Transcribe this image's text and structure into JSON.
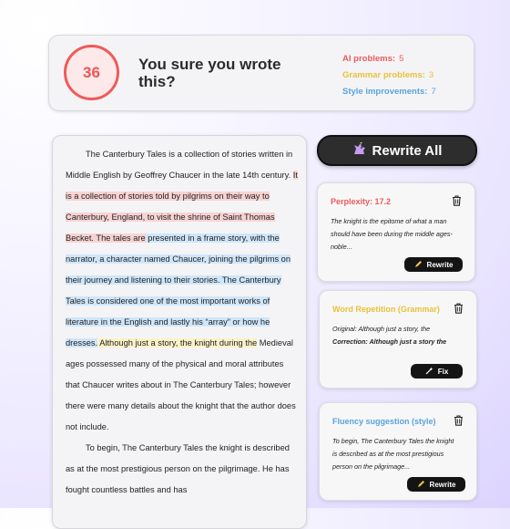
{
  "score": {
    "value": "36",
    "title": "You sure you wrote this?",
    "stats": [
      {
        "label": "AI problems:",
        "value": "5"
      },
      {
        "label": "Grammar problems:",
        "value": "3"
      },
      {
        "label": "Style improvements:",
        "value": "7"
      }
    ]
  },
  "document": {
    "p1_plain": "The Canterbury Tales is a collection of stories written in Middle English by Geoffrey Chaucer in the late 14th century. ",
    "p1_red": "It is a collection of stories told by pilgrims on their way to Canterbury, England, to visit the shrine of Saint Thomas Becket. The tales are",
    "p1_blue": " presented in a frame story, with the narrator, a character named Chaucer, joining the pilgrims on their journey and listening to their stories. The Canterbury Tales is considered one of the most important works of literature in the English and lastly his “array” or how he dresses.",
    "p1_yellow": " Although just a story, the knight during the",
    "p1_tail": " Medieval ages possessed many of the physical and moral attributes that Chaucer writes about in The Canterbury Tales; however there were many details about the knight that the author does not include.",
    "p2": "To begin, The Canterbury Tales the knight is described as at the most prestigious person on the pilgrimage. He has fought countless battles and has"
  },
  "rewrite_all": {
    "label": "Rewrite All",
    "icon": "unicorn-icon"
  },
  "suggestions": [
    {
      "title": "Perplexity: 17.2",
      "title_color": "#ec5b5b",
      "body": "The knight is the epitome of what a man should have been during the middle ages- noble...",
      "button": "Rewrite"
    },
    {
      "title": "Word Repetition (Grammar)",
      "title_color": "#e7c23a",
      "original_label": "Original:",
      "original_text": "Although just a story, the",
      "correction_label": "Correction:",
      "correction_text": "Although just a story the",
      "button": "Fix"
    },
    {
      "title": "Fluency suggestion (style)",
      "title_color": "#5aa3dc",
      "body": "To begin, The Canterbury Tales the knight is described as at the most prestigious person on the pilgrimage...",
      "button": "Rewrite"
    }
  ]
}
